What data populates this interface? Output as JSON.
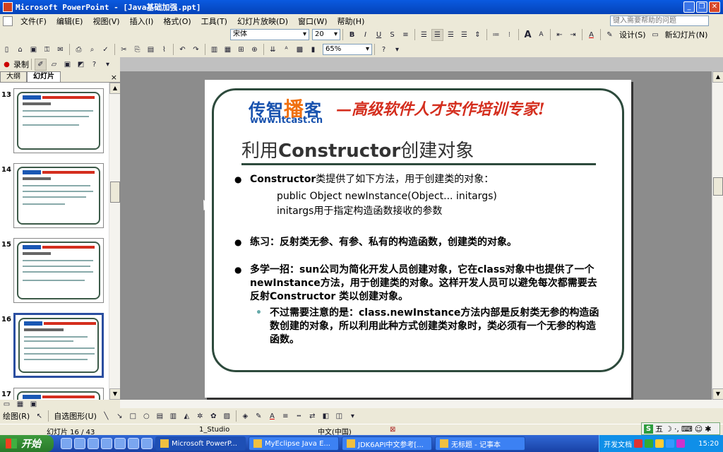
{
  "window": {
    "title": "Microsoft PowerPoint - [Java基础加强.ppt]",
    "controls": [
      "_",
      "❐",
      "✕"
    ]
  },
  "menu": {
    "items": [
      "文件(F)",
      "编辑(E)",
      "视图(V)",
      "插入(I)",
      "格式(O)",
      "工具(T)",
      "幻灯片放映(D)",
      "窗口(W)",
      "帮助(H)"
    ],
    "help_placeholder": "键入需要帮助的问题"
  },
  "format_toolbar": {
    "font": "宋体",
    "size": "20",
    "design_label": "设计(S)",
    "new_slide_label": "新幻灯片(N)"
  },
  "standard_toolbar": {
    "zoom": "65%"
  },
  "review_toolbar": {
    "record_label": "录制"
  },
  "outline_pane": {
    "tabs": [
      "大纲",
      "幻灯片"
    ],
    "close": "×",
    "slide_numbers": [
      "13",
      "14",
      "15",
      "16",
      "17"
    ],
    "selected_index": 3
  },
  "slide": {
    "logo_cn_a": "传智",
    "logo_cn_b": "播",
    "logo_cn_c": "客",
    "logo_url": "www.itcast.cn",
    "slogan": "—高级软件人才实作培训专家!",
    "title_pre": "利用",
    "title_bold": "Constructor",
    "title_post": "创建对象",
    "b1_bold": "Constructor",
    "b1_rest": "类提供了如下方法，用于创建类的对象：",
    "b1_sub1": "public Object newInstance(Object... initargs)",
    "b1_sub2": "initargs用于指定构造函数接收的参数",
    "b2": "练习：反射类无参、有参、私有的构造函数，创建类的对象。",
    "b3_a": "多学一招：",
    "b3_b": "sun",
    "b3_c": "公司为简化开发人员创建对象，它在",
    "b3_d": "class",
    "b3_e": "对象中也提供了一个",
    "b3_f": "newInstance",
    "b3_g": "方法，用于创建类的对象。这样开发人员可以避免每次都需要去反射",
    "b3_h": "Constructor",
    "b3_i": " 类以创建对象。",
    "b3_sub": "不过需要注意的是：class.newInstance方法内部是反射类无参的构造函数创建的对象，所以利用此种方式创建类对象时，类必须有一个无参的构造函数。"
  },
  "draw_toolbar": {
    "draw_label": "绘图(R)",
    "autoshape_label": "自选图形(U)"
  },
  "status": {
    "slide_pos": "幻灯片 16 / 43",
    "design": "1_Studio",
    "language": "中文(中国)"
  },
  "taskbar": {
    "start": "开始",
    "tasks": [
      "Microsoft PowerP...",
      "MyEclipse Java E...",
      "JDK6API中文参考[...",
      "无标题 - 记事本",
      "开发文档"
    ],
    "time": "15:20"
  },
  "ime": {
    "label": "五"
  }
}
